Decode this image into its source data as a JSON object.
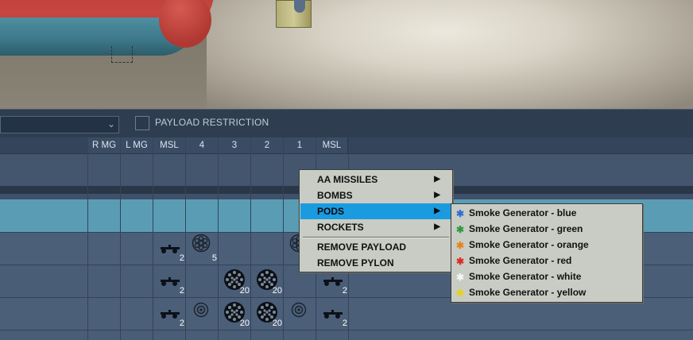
{
  "toolbar": {
    "restriction_label": "PAYLOAD RESTRICTION",
    "combo_value": ""
  },
  "columns": [
    "R MG",
    "L MG",
    "MSL",
    "4",
    "3",
    "2",
    "1",
    "MSL"
  ],
  "grid": [
    [],
    [],
    [
      {
        "col": 2,
        "icon": "missile-icon",
        "count": "2"
      },
      {
        "col": 3,
        "icon": "rocket-pod-7-icon",
        "count": "5"
      },
      {
        "col": 6,
        "icon": "rocket-pod-7-icon",
        "count": ""
      }
    ],
    [
      {
        "col": 2,
        "icon": "missile-icon",
        "count": "2"
      },
      {
        "col": 4,
        "icon": "rocket-pod-20-icon",
        "count": "20"
      },
      {
        "col": 5,
        "icon": "rocket-pod-20-icon",
        "count": "20"
      },
      {
        "col": 7,
        "icon": "missile-icon",
        "count": "2"
      }
    ],
    [
      {
        "col": 2,
        "icon": "missile-icon",
        "count": "2"
      },
      {
        "col": 3,
        "icon": "smoke-pod-icon",
        "count": ""
      },
      {
        "col": 4,
        "icon": "rocket-pod-20-icon",
        "count": "20"
      },
      {
        "col": 5,
        "icon": "rocket-pod-20-icon",
        "count": "20"
      },
      {
        "col": 6,
        "icon": "smoke-pod-icon",
        "count": ""
      },
      {
        "col": 7,
        "icon": "missile-icon",
        "count": "2"
      }
    ]
  ],
  "context_menu": {
    "items": [
      "AA MISSILES",
      "BOMBS",
      "PODS",
      "ROCKETS",
      "REMOVE PAYLOAD",
      "REMOVE PYLON"
    ],
    "highlighted": "PODS"
  },
  "submenu": {
    "items": [
      {
        "label": "Smoke Generator - blue",
        "color": "#2f6fd6"
      },
      {
        "label": "Smoke Generator - green",
        "color": "#2e9a3c"
      },
      {
        "label": "Smoke Generator - orange",
        "color": "#e8841c"
      },
      {
        "label": "Smoke Generator - red",
        "color": "#e02a24"
      },
      {
        "label": "Smoke Generator - white",
        "color": "#f4f4f4"
      },
      {
        "label": "Smoke Generator - yellow",
        "color": "#e8d21c"
      }
    ]
  },
  "colors": {
    "menu_highlight": "#1a9be0",
    "selected_row": "#5a9cb4",
    "panel_bg": "#3f5068"
  }
}
